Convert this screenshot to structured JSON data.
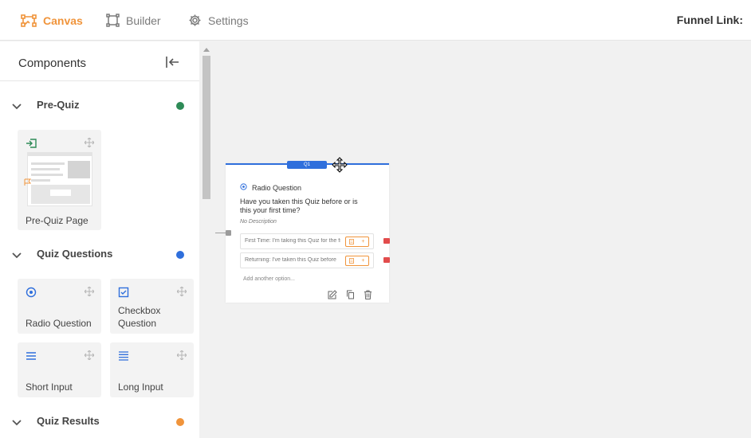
{
  "nav": {
    "tabs": [
      {
        "label": "Canvas",
        "icon": "canvas-icon",
        "active": true
      },
      {
        "label": "Builder",
        "icon": "builder-icon",
        "active": false
      },
      {
        "label": "Settings",
        "icon": "gear-icon",
        "active": false
      }
    ],
    "funnel_link_label": "Funnel Link:"
  },
  "sidebar": {
    "title": "Components",
    "sections": [
      {
        "label": "Pre-Quiz",
        "dot_color": "#2e8b57",
        "items": [
          {
            "label": "Pre-Quiz Page",
            "icon": "login-icon"
          }
        ]
      },
      {
        "label": "Quiz Questions",
        "dot_color": "#2f6fdc",
        "items": [
          {
            "label": "Radio Question",
            "icon": "radio-icon"
          },
          {
            "label": "Checkbox Question",
            "icon": "checkbox-icon"
          },
          {
            "label": "Short Input",
            "icon": "short-input-icon"
          },
          {
            "label": "Long Input",
            "icon": "long-input-icon"
          }
        ]
      },
      {
        "label": "Quiz Results",
        "dot_color": "#f0943b",
        "items": []
      }
    ]
  },
  "canvas": {
    "question_node": {
      "badge": "Q1",
      "type_label": "Radio Question",
      "question": "Have you taken this Quiz before or is this your first time?",
      "description": "No Description",
      "options": [
        {
          "text": "First Time: I'm taking this Quiz for the first time"
        },
        {
          "text": "Returning: I've taken this Quiz before"
        }
      ],
      "score_plus": "+",
      "add_option_placeholder": "Add another option..."
    }
  },
  "colors": {
    "accent": "#f0943b",
    "primary_blue": "#2f6fdc",
    "port_red": "#e24c4c"
  }
}
